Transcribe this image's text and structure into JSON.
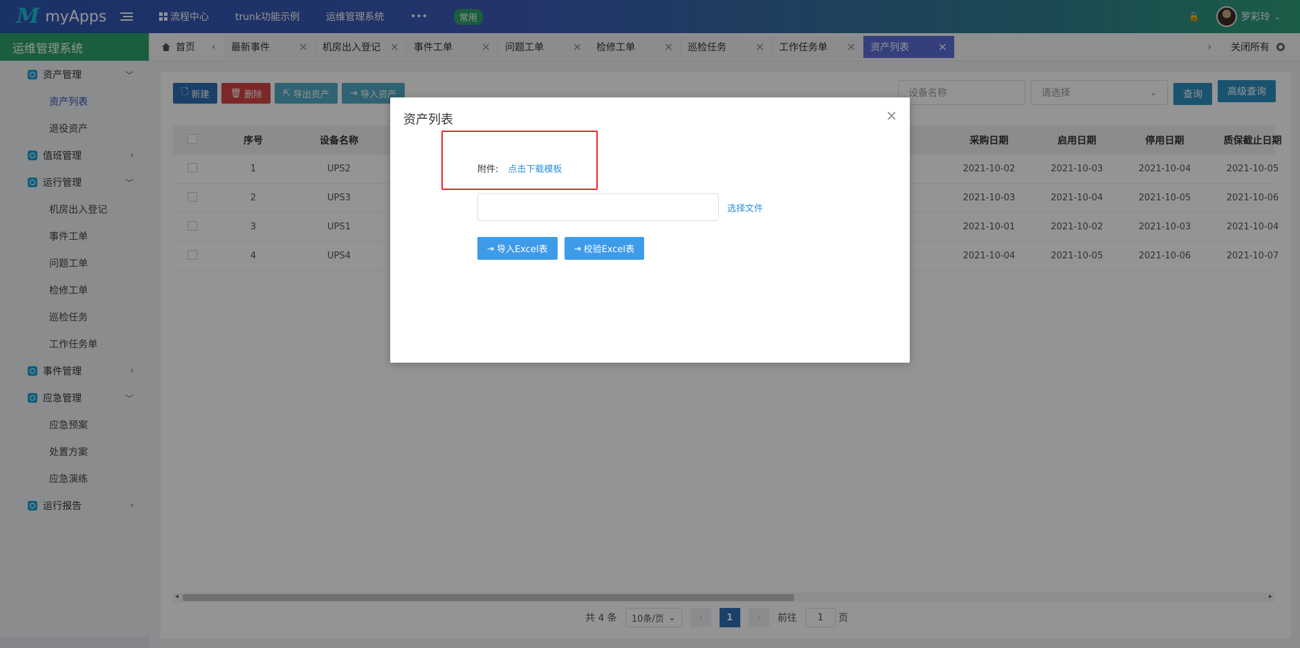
{
  "app": {
    "logo_mark": "M",
    "logo_text": "myApps"
  },
  "topnav": {
    "items": [
      "流程中心",
      "trunk功能示例",
      "运维管理系统",
      "•••"
    ],
    "badge": "常用"
  },
  "user": {
    "name": "罗彩玲",
    "lock_icon": "lock-icon"
  },
  "sidebar": {
    "title": "运维管理系统",
    "groups": [
      {
        "label": "资产管理",
        "items": [
          "资产列表",
          "退役资产"
        ]
      },
      {
        "label": "值班管理",
        "items": []
      },
      {
        "label": "运行管理",
        "items": [
          "机房出入登记",
          "事件工单",
          "问题工单",
          "检修工单",
          "巡检任务",
          "工作任务单"
        ]
      },
      {
        "label": "事件管理",
        "items": []
      },
      {
        "label": "应急管理",
        "items": [
          "应急预案",
          "处置方案",
          "应急演练"
        ]
      },
      {
        "label": "运行报告",
        "items": []
      }
    ]
  },
  "tabs": {
    "home": "首页",
    "items": [
      "最新事件",
      "机房出入登记",
      "事件工单",
      "问题工单",
      "检修工单",
      "巡检任务",
      "工作任务单",
      "资产列表"
    ],
    "close_all": "关闭所有"
  },
  "toolbar": {
    "new": "新建",
    "delete": "删除",
    "export": "导出资产",
    "import": "导入资产"
  },
  "search": {
    "name_placeholder": "设备名称",
    "select_placeholder": "请选择",
    "query": "查询",
    "advanced": "高级查询"
  },
  "table": {
    "headers": {
      "seq": "序号",
      "name": "设备名称",
      "purchase": "采购日期",
      "enable": "启用日期",
      "disable": "停用日期",
      "warranty": "质保截止日期"
    },
    "rows": [
      {
        "seq": "1",
        "name": "UPS2",
        "purchase": "2021-10-02",
        "enable": "2021-10-03",
        "disable": "2021-10-04",
        "warranty": "2021-10-05"
      },
      {
        "seq": "2",
        "name": "UPS3",
        "purchase": "2021-10-03",
        "enable": "2021-10-04",
        "disable": "2021-10-05",
        "warranty": "2021-10-06"
      },
      {
        "seq": "3",
        "name": "UPS1",
        "purchase": "2021-10-01",
        "enable": "2021-10-02",
        "disable": "2021-10-03",
        "warranty": "2021-10-04"
      },
      {
        "seq": "4",
        "name": "UPS4",
        "purchase": "2021-10-04",
        "enable": "2021-10-05",
        "disable": "2021-10-06",
        "warranty": "2021-10-07"
      }
    ]
  },
  "pager": {
    "total": "共 4 条",
    "size": "10条/页",
    "current": "1",
    "goto_label": "前往",
    "goto_value": "1",
    "page_suffix": "页"
  },
  "modal": {
    "title": "资产列表",
    "attach_label": "附件:",
    "download_link": "点击下载模板",
    "choose_file": "选择文件",
    "import_btn": "导入Excel表",
    "verify_btn": "校验Excel表"
  },
  "colors": {
    "accent": "#2ea36b",
    "primary": "#2d6fb6",
    "highlight": "#e8262d",
    "link": "#2f8fdc"
  }
}
